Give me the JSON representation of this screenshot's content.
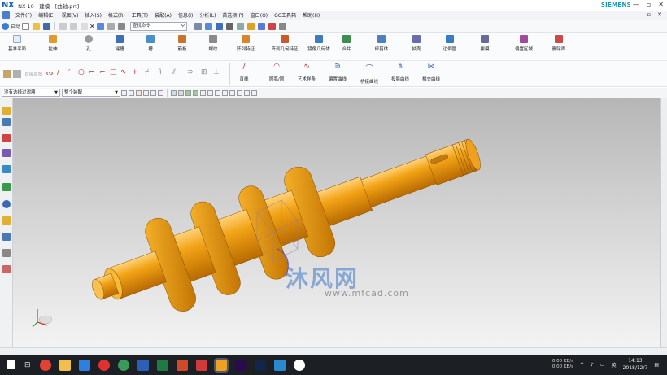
{
  "window": {
    "logo": "NX",
    "title": "NX 10 - 建模 - [曲轴.prt]",
    "brand": "SIEMENS",
    "controls": [
      "—",
      "▫",
      "✕"
    ]
  },
  "menubar": {
    "items": [
      "文件(F)",
      "编辑(E)",
      "视图(V)",
      "插入(S)",
      "格式(R)",
      "工具(T)",
      "装配(A)",
      "信息(I)",
      "分析(L)",
      "首选项(P)",
      "窗口(O)",
      "GC工具箱",
      "帮助(H)"
    ],
    "right_controls": [
      "—",
      "▫",
      "✕"
    ]
  },
  "qat": {
    "start_label": "启动",
    "search_placeholder": "查找命令"
  },
  "ribbon1": {
    "items": [
      {
        "label": "基准平面",
        "color": "#8fa7c6"
      },
      {
        "label": "拉伸",
        "color": "#e39a2c"
      },
      {
        "label": "孔",
        "color": "#9a9a9a"
      },
      {
        "label": "键槽",
        "color": "#3e6fb8"
      },
      {
        "label": "槽",
        "color": "#4a8fc9"
      },
      {
        "label": "筋板",
        "color": "#c8752c"
      },
      {
        "label": "螺纹",
        "color": "#8a8a8a"
      },
      {
        "label": "阵列特征",
        "color": "#d8862b"
      },
      {
        "label": "阵列几何特征",
        "color": "#c85a2c"
      },
      {
        "label": "镜像几何体",
        "color": "#3f7bc2"
      },
      {
        "label": "合并",
        "color": "#3e8f4f"
      },
      {
        "label": "修剪体",
        "color": "#4f7fbf"
      },
      {
        "label": "抽壳",
        "color": "#6b6bb0"
      },
      {
        "label": "边倒圆",
        "color": "#3a7bc4"
      },
      {
        "label": "拔模",
        "color": "#6a6a9a"
      },
      {
        "label": "偏置区域",
        "color": "#a04aa0"
      },
      {
        "label": "删除面",
        "color": "#c84a4a"
      }
    ]
  },
  "ribbon2": {
    "sketch_dropdown": "直接草图",
    "curve_items": [
      {
        "label": "直线"
      },
      {
        "label": "圆弧/圆"
      },
      {
        "label": "艺术样条"
      },
      {
        "label": "偏置曲线"
      },
      {
        "label": "桥接曲线"
      },
      {
        "label": "投影曲线"
      },
      {
        "label": "相交曲线"
      }
    ]
  },
  "filterbar": {
    "filter_select": "没有选择过滤器",
    "scope_select": "整个装配"
  },
  "watermark": {
    "main": "沐风网",
    "sub": "www.mfcad.com"
  },
  "taskbar": {
    "net_up": "0.00 KB/s",
    "net_down": "0.00 KB/s",
    "ime": "英",
    "time": "14:13",
    "date": "2018/12/7"
  }
}
